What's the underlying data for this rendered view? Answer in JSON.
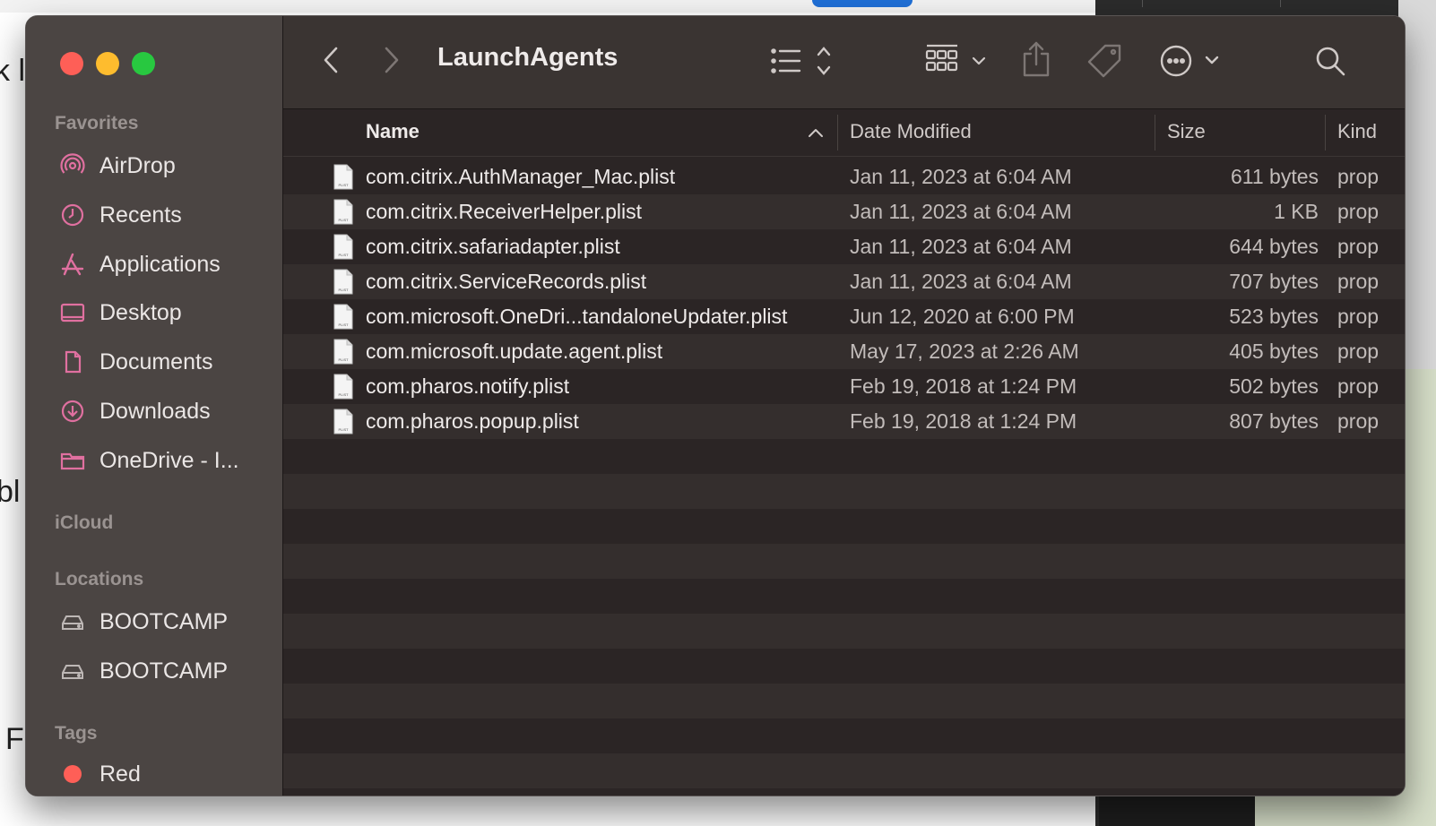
{
  "background": {
    "left_fragments": [
      "k li",
      "bl",
      "F"
    ]
  },
  "window": {
    "title": "LaunchAgents"
  },
  "sidebar": {
    "sections": {
      "favorites": "Favorites",
      "icloud": "iCloud",
      "locations": "Locations",
      "tags": "Tags"
    },
    "favorites": [
      {
        "label": "AirDrop",
        "icon": "airdrop-icon"
      },
      {
        "label": "Recents",
        "icon": "clock-icon"
      },
      {
        "label": "Applications",
        "icon": "applications-icon"
      },
      {
        "label": "Desktop",
        "icon": "desktop-icon"
      },
      {
        "label": "Documents",
        "icon": "document-icon"
      },
      {
        "label": "Downloads",
        "icon": "download-icon"
      },
      {
        "label": "OneDrive - I...",
        "icon": "folder-icon"
      }
    ],
    "locations": [
      {
        "label": "BOOTCAMP",
        "icon": "disk-icon"
      },
      {
        "label": "BOOTCAMP",
        "icon": "disk-icon"
      }
    ],
    "tags": [
      {
        "label": "Red",
        "color": "#fe5f57"
      }
    ]
  },
  "columns": {
    "name": "Name",
    "date": "Date Modified",
    "size": "Size",
    "kind": "Kind"
  },
  "files": [
    {
      "name": "com.citrix.AuthManager_Mac.plist",
      "date": "Jan 11, 2023 at 6:04 AM",
      "size": "611 bytes",
      "kind": "prop"
    },
    {
      "name": "com.citrix.ReceiverHelper.plist",
      "date": "Jan 11, 2023 at 6:04 AM",
      "size": "1 KB",
      "kind": "prop"
    },
    {
      "name": "com.citrix.safariadapter.plist",
      "date": "Jan 11, 2023 at 6:04 AM",
      "size": "644 bytes",
      "kind": "prop"
    },
    {
      "name": "com.citrix.ServiceRecords.plist",
      "date": "Jan 11, 2023 at 6:04 AM",
      "size": "707 bytes",
      "kind": "prop"
    },
    {
      "name": "com.microsoft.OneDri...tandaloneUpdater.plist",
      "date": "Jun 12, 2020 at 6:00 PM",
      "size": "523 bytes",
      "kind": "prop"
    },
    {
      "name": "com.microsoft.update.agent.plist",
      "date": "May 17, 2023 at 2:26 AM",
      "size": "405 bytes",
      "kind": "prop"
    },
    {
      "name": "com.pharos.notify.plist",
      "date": "Feb 19, 2018 at 1:24 PM",
      "size": "502 bytes",
      "kind": "prop"
    },
    {
      "name": "com.pharos.popup.plist",
      "date": "Feb 19, 2018 at 1:24 PM",
      "size": "807 bytes",
      "kind": "prop"
    }
  ],
  "file_icon_label": "PLIST",
  "colors": {
    "sidebar_bg": "#4b4543",
    "content_bg": "#2b2525",
    "row_alt_bg": "#342e2d",
    "accent_pink": "#e070a0"
  }
}
